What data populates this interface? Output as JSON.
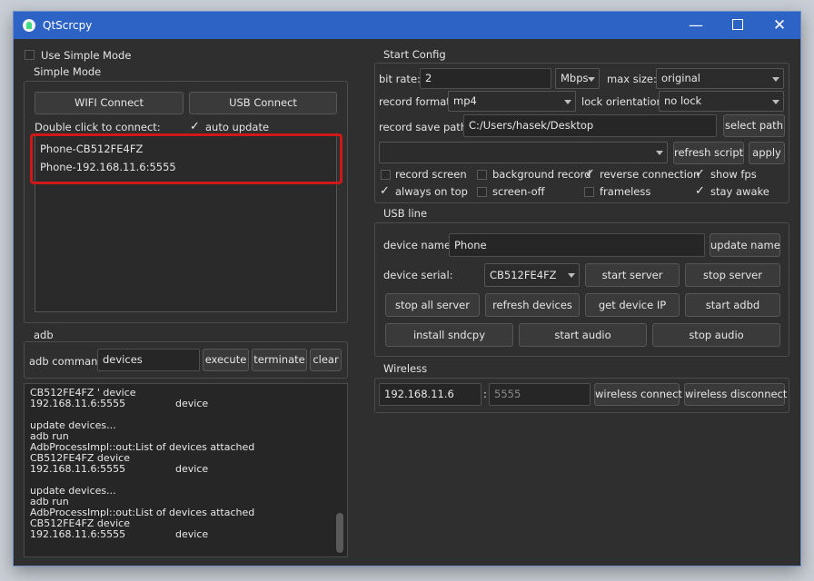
{
  "window": {
    "title": "QtScrcpy"
  },
  "left": {
    "simple_mode_toggle": "Use Simple Mode",
    "simple_mode_group": "Simple Mode",
    "wifi_connect": "WIFI Connect",
    "usb_connect": "USB Connect",
    "double_click_hint": "Double click to connect:",
    "auto_update": "auto update",
    "devices": [
      "Phone-CB512FE4FZ",
      "Phone-192.168.11.6:5555"
    ],
    "adb_group": "adb",
    "adb_command_label": "adb command:",
    "adb_command_value": "devices",
    "execute": "execute",
    "terminate": "terminate",
    "clear": "clear",
    "log_lines": [
      {
        "a": "CB512FE4FZ  ' device",
        "b": ""
      },
      {
        "a": "192.168.11.6:5555",
        "b": "device"
      },
      {
        "a": "",
        "b": ""
      },
      {
        "a": "update devices...",
        "b": ""
      },
      {
        "a": "adb run",
        "b": ""
      },
      {
        "a": "AdbProcessImpl::out:List of devices attached",
        "b": ""
      },
      {
        "a": "CB512FE4FZ    device",
        "b": ""
      },
      {
        "a": "192.168.11.6:5555",
        "b": "device"
      },
      {
        "a": "",
        "b": ""
      },
      {
        "a": "update devices...",
        "b": ""
      },
      {
        "a": "adb run",
        "b": ""
      },
      {
        "a": "AdbProcessImpl::out:List of devices attached",
        "b": ""
      },
      {
        "a": "CB512FE4FZ    device",
        "b": ""
      },
      {
        "a": "192.168.11.6:5555",
        "b": "device"
      }
    ]
  },
  "start_config": {
    "group": "Start Config",
    "bit_rate_label": "bit rate:",
    "bit_rate_value": "2",
    "bit_rate_unit": "Mbps",
    "max_size_label": "max size:",
    "max_size_value": "original",
    "record_format_label": "record format:",
    "record_format_value": "mp4",
    "lock_orientation_label": "lock orientation:",
    "lock_orientation_value": "no lock",
    "record_save_path_label": "record save path:",
    "record_save_path_value": "C:/Users/hasek/Desktop",
    "select_path": "select path",
    "refresh_script": "refresh script",
    "apply": "apply",
    "options": {
      "record_screen": "record screen",
      "background_record": "background record",
      "reverse_connection": "reverse connection",
      "show_fps": "show fps",
      "always_on_top": "always on top",
      "screen_off": "screen-off",
      "frameless": "frameless",
      "stay_awake": "stay awake"
    }
  },
  "usb": {
    "group": "USB line",
    "device_name_label": "device name:",
    "device_name_value": "Phone",
    "update_name": "update name",
    "device_serial_label": "device serial:",
    "device_serial_value": "CB512FE4FZ",
    "start_server": "start server",
    "stop_server": "stop server",
    "stop_all_server": "stop all server",
    "refresh_devices": "refresh devices",
    "get_device_ip": "get device IP",
    "start_adbd": "start adbd",
    "install_sndcpy": "install sndcpy",
    "start_audio": "start audio",
    "stop_audio": "stop audio"
  },
  "wireless": {
    "group": "Wireless",
    "ip_value": "192.168.11.6",
    "separator": ":",
    "port_placeholder": "5555",
    "wireless_connect": "wireless connect",
    "wireless_disconnect": "wireless disconnect"
  },
  "colors": {
    "titlebar": "#2c63c4",
    "highlight": "#d01818",
    "window_bg": "#2f2f2f"
  }
}
